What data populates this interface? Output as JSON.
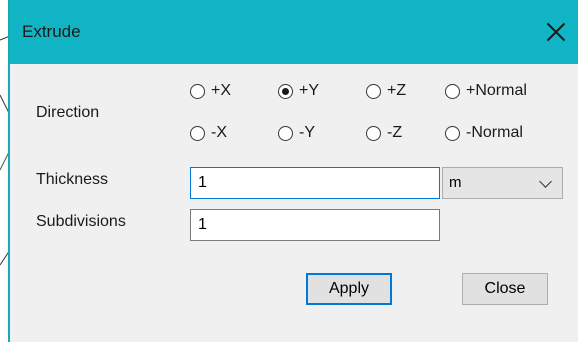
{
  "window": {
    "title": "Extrude"
  },
  "labels": {
    "direction": "Direction",
    "thickness": "Thickness",
    "subdivisions": "Subdivisions"
  },
  "direction_options": [
    {
      "label": "+X",
      "checked": false
    },
    {
      "label": "+Y",
      "checked": true
    },
    {
      "label": "+Z",
      "checked": false
    },
    {
      "label": "+Normal",
      "checked": false
    },
    {
      "label": "-X",
      "checked": false
    },
    {
      "label": "-Y",
      "checked": false
    },
    {
      "label": "-Z",
      "checked": false
    },
    {
      "label": "-Normal",
      "checked": false
    }
  ],
  "thickness": {
    "value": "1",
    "unit": "m"
  },
  "subdivisions": {
    "value": "1"
  },
  "buttons": {
    "apply": "Apply",
    "close": "Close"
  },
  "colors": {
    "titlebar": "#11b4c4",
    "focus": "#0078d7"
  }
}
